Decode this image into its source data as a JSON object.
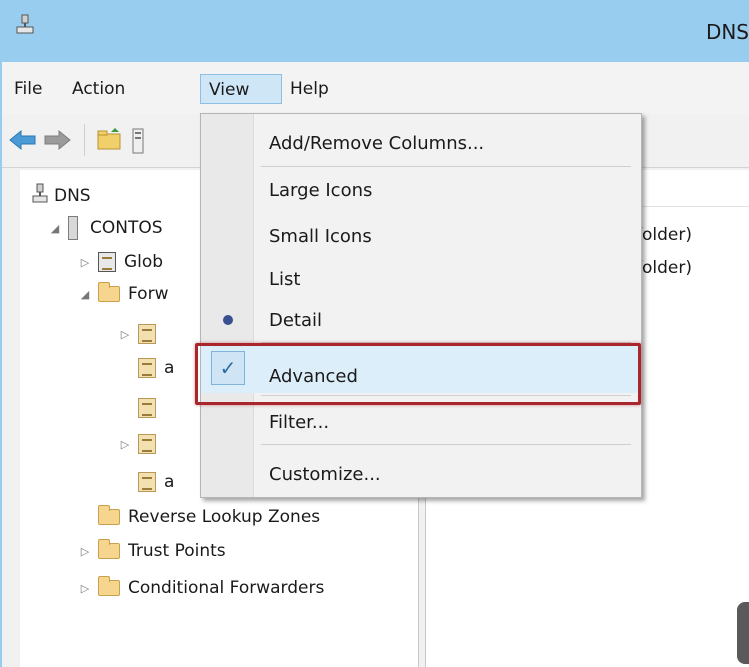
{
  "window": {
    "title": "DNS"
  },
  "menubar": {
    "items": [
      "File",
      "Action",
      "View",
      "Help"
    ]
  },
  "toolbar": {
    "icons": [
      "back-arrow-icon",
      "forward-arrow-icon",
      "folder-up-icon",
      "show-hide-tree-icon"
    ]
  },
  "tree": {
    "root": "DNS",
    "server": "CONTOS",
    "global": "Glob",
    "forward": "Forw",
    "child3": "a",
    "child6": "a",
    "reverse": "Reverse Lookup Zones",
    "trust": "Trust Points",
    "conditional": "Conditional Forwarders"
  },
  "right_pane": {
    "rows": [
      "folder)",
      "folder)"
    ]
  },
  "view_menu": {
    "items": {
      "add_remove": "Add/Remove Columns...",
      "large_icons": "Large Icons",
      "small_icons": "Small Icons",
      "list": "List",
      "detail": "Detail",
      "advanced": "Advanced",
      "filter": "Filter...",
      "customize": "Customize..."
    },
    "checked": "Advanced",
    "selected_view": "Detail",
    "check_glyph": "✓"
  },
  "colors": {
    "titlebar": "#98cdf0",
    "highlight": "#a8262c"
  }
}
